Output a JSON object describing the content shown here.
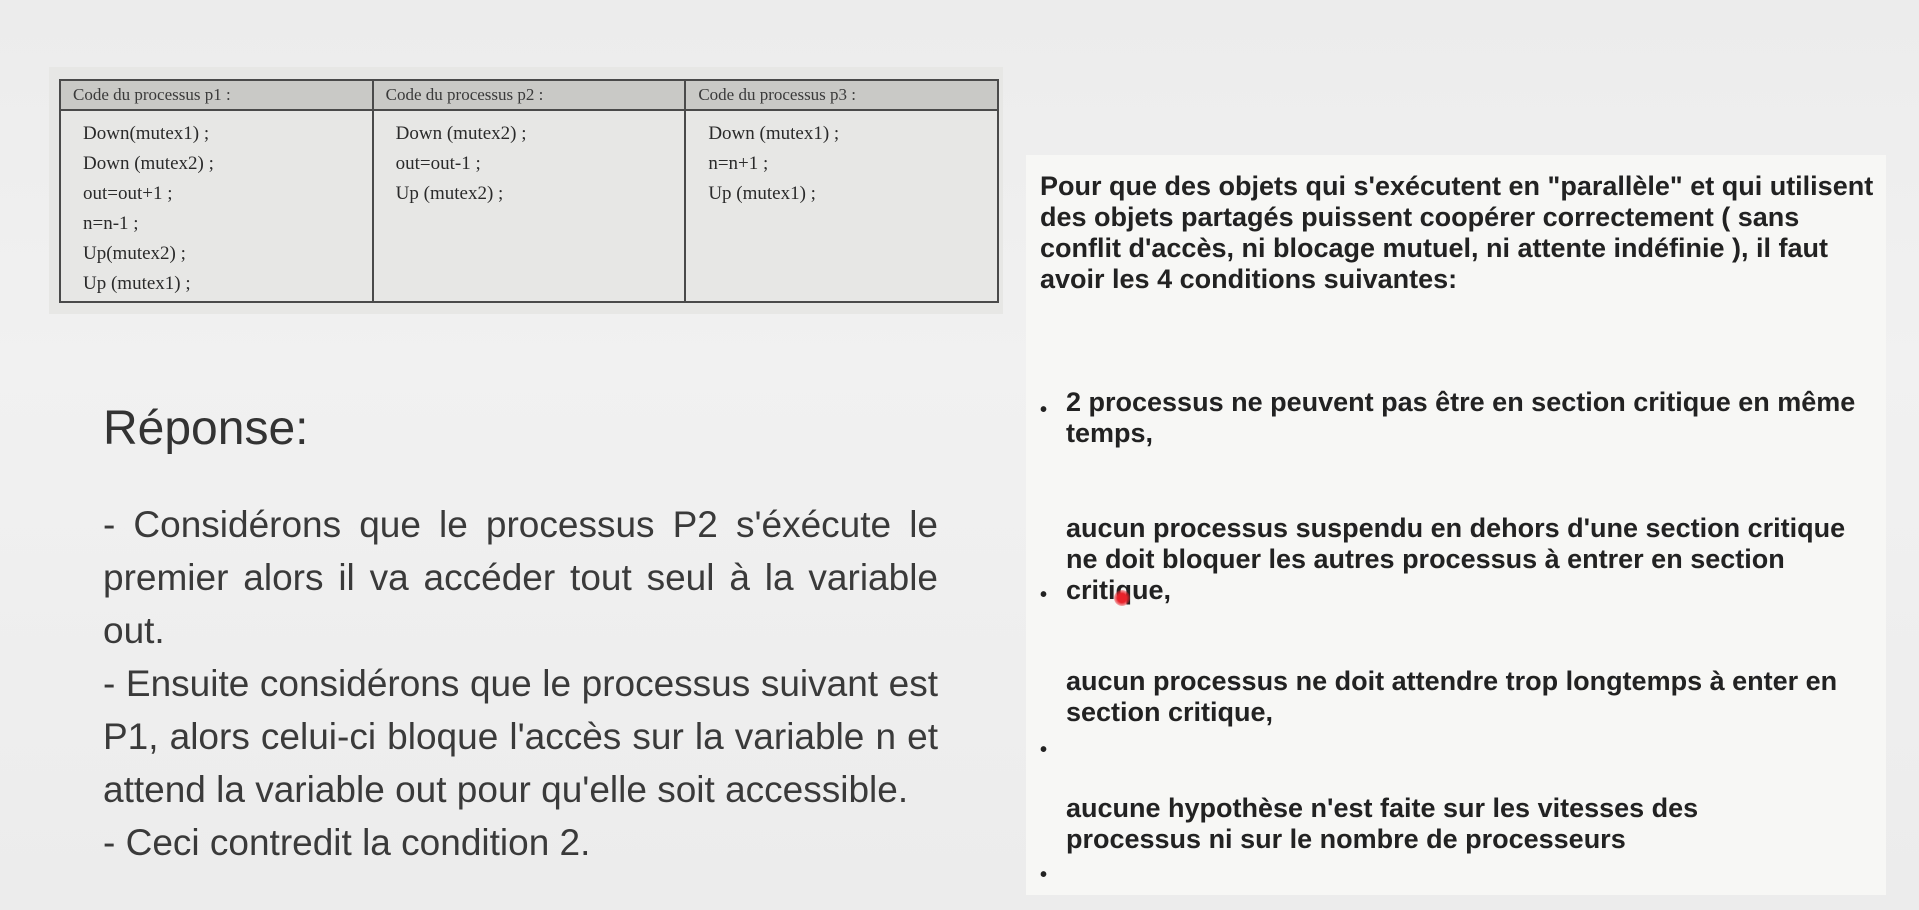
{
  "code_table": {
    "headers": [
      "Code du processus p1 :",
      "Code du processus p2 :",
      "Code du processus p3 :"
    ],
    "p1_lines": [
      "Down(mutex1) ;",
      "Down (mutex2) ;",
      "out=out+1 ;",
      "n=n-1 ;",
      "Up(mutex2) ;",
      "Up (mutex1) ;"
    ],
    "p2_lines": [
      "Down (mutex2) ;",
      "out=out-1 ;",
      "Up (mutex2) ;"
    ],
    "p3_lines": [
      "Down (mutex1) ;",
      "n=n+1 ;",
      "Up (mutex1) ;"
    ]
  },
  "answer": {
    "title": "Réponse:",
    "paragraphs": [
      "- Considérons que le processus P2 s'éxécute le premier alors il va accéder tout seul à la variable out.",
      "- Ensuite considérons que le processus suivant est P1, alors celui-ci bloque l'accès sur la variable n et attend la variable out pour qu'elle soit accessible.",
      "- Ceci contredit la condition 2."
    ]
  },
  "conditions": {
    "intro": "Pour que des objets qui s'exécutent en \"parallèle\" et qui utilisent des objets partagés puissent coopérer correctement ( sans conflit d'accès, ni blocage mutuel, ni attente indéfinie ), il faut avoir les 4 conditions suivantes:",
    "bullet_symbol": "•",
    "items": [
      "2 processus ne peuvent pas être en section critique en même temps,",
      "aucun processus suspendu en dehors d'une section critique ne doit bloquer les autres processus à entrer en section critique,",
      "aucun processus ne doit attendre trop longtemps à enter en section critique,",
      "aucune hypothèse n'est faite sur les vitesses des processus ni sur le nombre de processeurs"
    ]
  },
  "cursor_color": "#e8232b"
}
